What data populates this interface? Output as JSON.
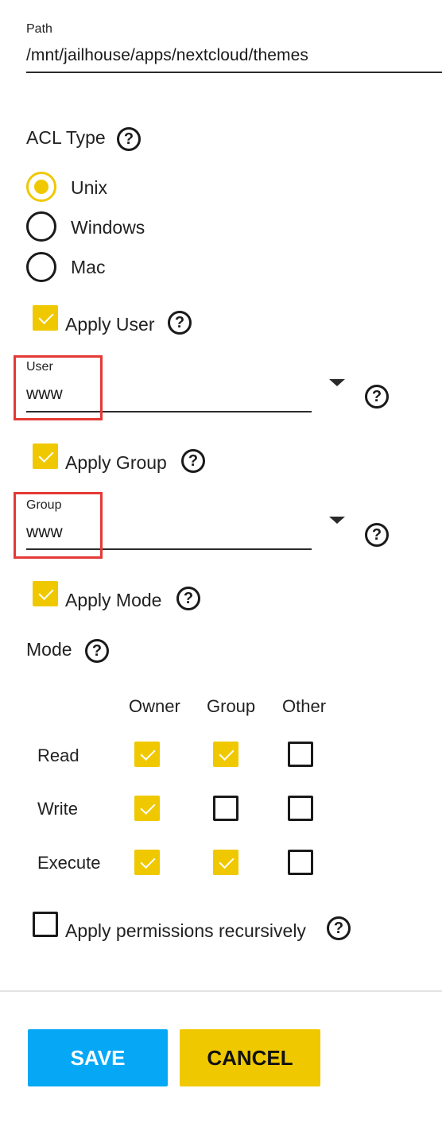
{
  "path": {
    "label": "Path",
    "value": "/mnt/jailhouse/apps/nextcloud/themes"
  },
  "acl": {
    "label": "ACL Type",
    "options": [
      "Unix",
      "Windows",
      "Mac"
    ],
    "selected": "Unix"
  },
  "apply_user": {
    "label": "Apply User",
    "checked": true
  },
  "user": {
    "label": "User",
    "value": "www"
  },
  "apply_group": {
    "label": "Apply Group",
    "checked": true
  },
  "group": {
    "label": "Group",
    "value": "www"
  },
  "apply_mode": {
    "label": "Apply Mode",
    "checked": true
  },
  "mode": {
    "label": "Mode",
    "columns": [
      "Owner",
      "Group",
      "Other"
    ],
    "rows": [
      {
        "label": "Read",
        "values": [
          true,
          true,
          false
        ]
      },
      {
        "label": "Write",
        "values": [
          true,
          false,
          false
        ]
      },
      {
        "label": "Execute",
        "values": [
          true,
          true,
          false
        ]
      }
    ]
  },
  "recursive": {
    "label": "Apply permissions recursively",
    "checked": false
  },
  "buttons": {
    "save": "SAVE",
    "cancel": "CANCEL"
  },
  "colors": {
    "accent": "#f0c800",
    "save": "#06a8f6",
    "cancel": "#f0c800",
    "highlight": "#e53935"
  },
  "icons": {
    "help": "help-circle-icon",
    "dropdown": "caret-down-icon"
  }
}
